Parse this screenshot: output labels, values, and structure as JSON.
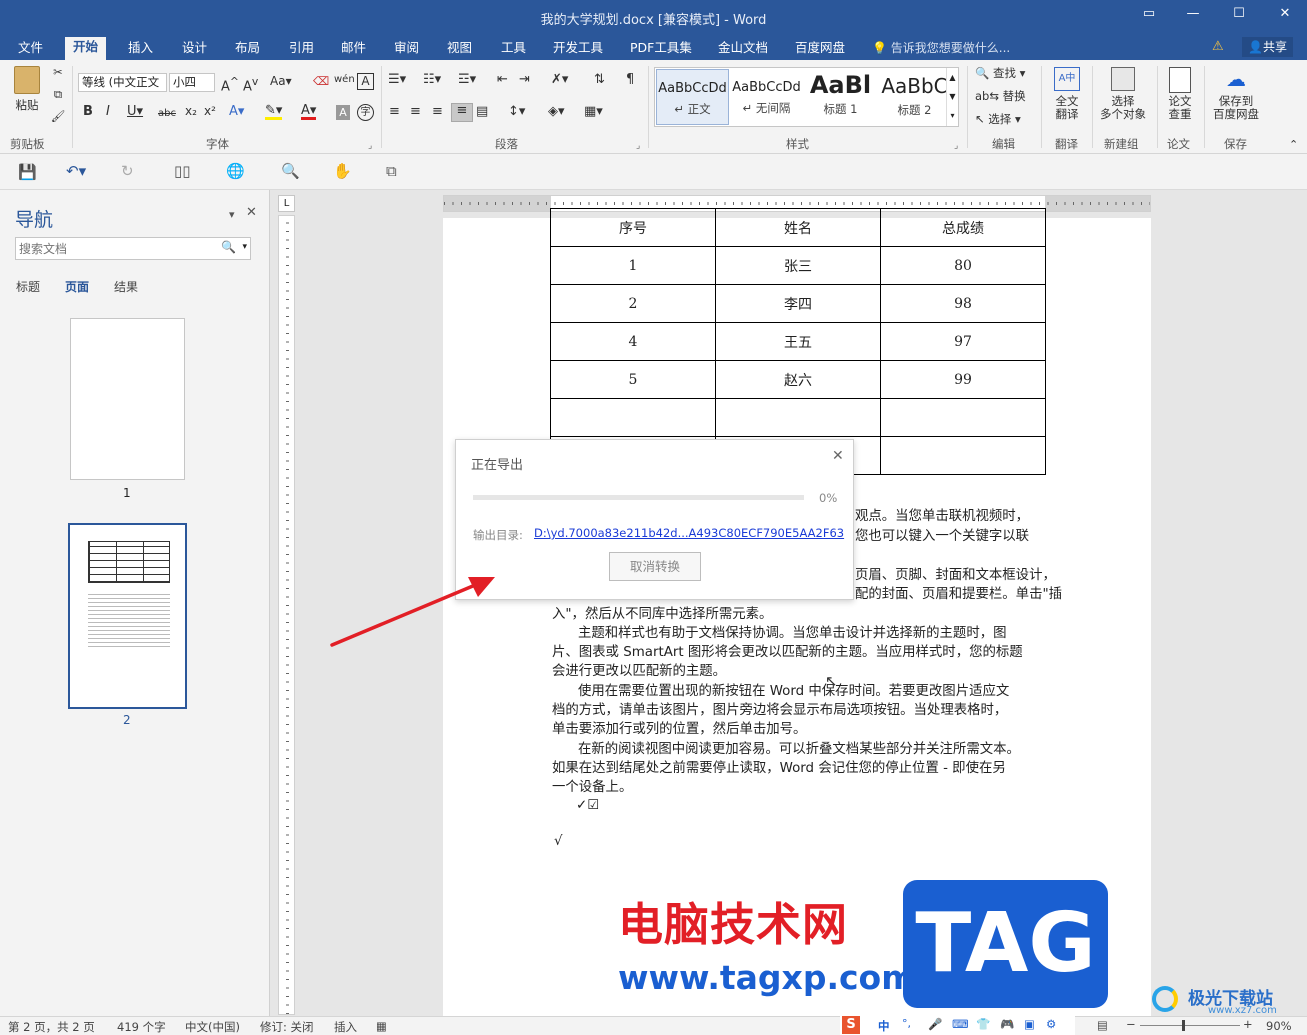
{
  "window": {
    "title": "我的大学规划.docx [兼容模式] - Word"
  },
  "menu": {
    "tabs": [
      "文件",
      "开始",
      "插入",
      "设计",
      "布局",
      "引用",
      "邮件",
      "审阅",
      "视图",
      "工具",
      "开发工具",
      "PDF工具集",
      "金山文档",
      "百度网盘"
    ],
    "active_tab": "开始",
    "search_placeholder": "告诉我您想要做什么...",
    "share": "共享"
  },
  "ribbon": {
    "clipboard": {
      "paste": "粘贴",
      "label": "剪贴板"
    },
    "font": {
      "name": "等线 (中文正文",
      "size": "小四",
      "label": "字体"
    },
    "paragraph": {
      "label": "段落"
    },
    "styles": {
      "label": "样式",
      "items": [
        {
          "preview": "AaBbCcDd",
          "name": "↵ 正文"
        },
        {
          "preview": "AaBbCcDd",
          "name": "↵ 无间隔"
        },
        {
          "preview": "AaBl",
          "name": "标题 1"
        },
        {
          "preview": "AaBbC",
          "name": "标题 2"
        }
      ]
    },
    "editing": {
      "find": "查找",
      "replace": "替换",
      "select": "选择",
      "label": "编辑"
    },
    "translate": {
      "full_line1": "全文",
      "full_line2": "翻译",
      "label": "翻译"
    },
    "newgroup": {
      "line1": "选择",
      "line2": "多个对象",
      "label": "新建组"
    },
    "paper": {
      "line1": "论文",
      "line2": "查重",
      "label": "论文"
    },
    "save": {
      "line1": "保存到",
      "line2": "百度网盘",
      "label": "保存"
    }
  },
  "nav": {
    "title": "导航",
    "search_placeholder": "搜索文档",
    "tabs": [
      "标题",
      "页面",
      "结果"
    ],
    "active_tab": "页面",
    "pages": [
      "1",
      "2"
    ]
  },
  "document": {
    "table": {
      "headers": [
        "序号",
        "姓名",
        "总成绩"
      ],
      "rows": [
        [
          "1",
          "张三",
          "80"
        ],
        [
          "2",
          "李四",
          "98"
        ],
        [
          "4",
          "王五",
          "97"
        ],
        [
          "5",
          "赵六",
          "99"
        ],
        [
          "",
          "",
          ""
        ],
        [
          "",
          "",
          ""
        ]
      ]
    },
    "paragraphs": [
      "观点。当您单击联机视频时，",
      "您也可以键入一个关键字以联",
      "页眉、页脚、封面和文本框设计，",
      "配的封面、页眉和提要栏。单击\"插",
      "入\"，然后从不同库中选择所需元素。",
      "主题和样式也有助于文档保持协调。当您单击设计并选择新的主题时，图",
      "片、图表或 SmartArt 图形将会更改以匹配新的主题。当应用样式时，您的标题",
      "会进行更改以匹配新的主题。",
      "使用在需要位置出现的新按钮在 Word 中保存时间。若要更改图片适应文",
      "档的方式，请单击该图片，图片旁边将会显示布局选项按钮。当处理表格时，",
      "单击要添加行或列的位置，然后单击加号。",
      "在新的阅读视图中阅读更加容易。可以折叠文档某些部分并关注所需文本。",
      "如果在达到结尾处之前需要停止读取，Word 会记住您的停止位置 - 即使在另",
      "一个设备上。",
      "✓☑",
      "√"
    ]
  },
  "dialog": {
    "title": "正在导出",
    "progress": 0,
    "progress_text": "0%",
    "output_label": "输出目录:",
    "output_path": "D:\\yd.7000a83e211b42d...A493C80ECF790E5AA2F63",
    "cancel": "取消转换"
  },
  "status": {
    "page": "第 2 页，共 2 页",
    "words": "419 个字",
    "lang": "中文(中国)",
    "track": "修订: 关闭",
    "mode": "插入",
    "zoom": "90%"
  },
  "ime": {
    "lang": "中",
    "punct": "°,"
  },
  "watermark": {
    "cn": "电脑技术网",
    "url": "www.tagxp.com",
    "tag": "TAG",
    "site": "极光下载站",
    "site_url": "www.xz7.com"
  },
  "colors": {
    "brand": "#2b579a",
    "link": "#1a3bd6",
    "red": "#e21f26",
    "blue": "#1a5fd1"
  }
}
